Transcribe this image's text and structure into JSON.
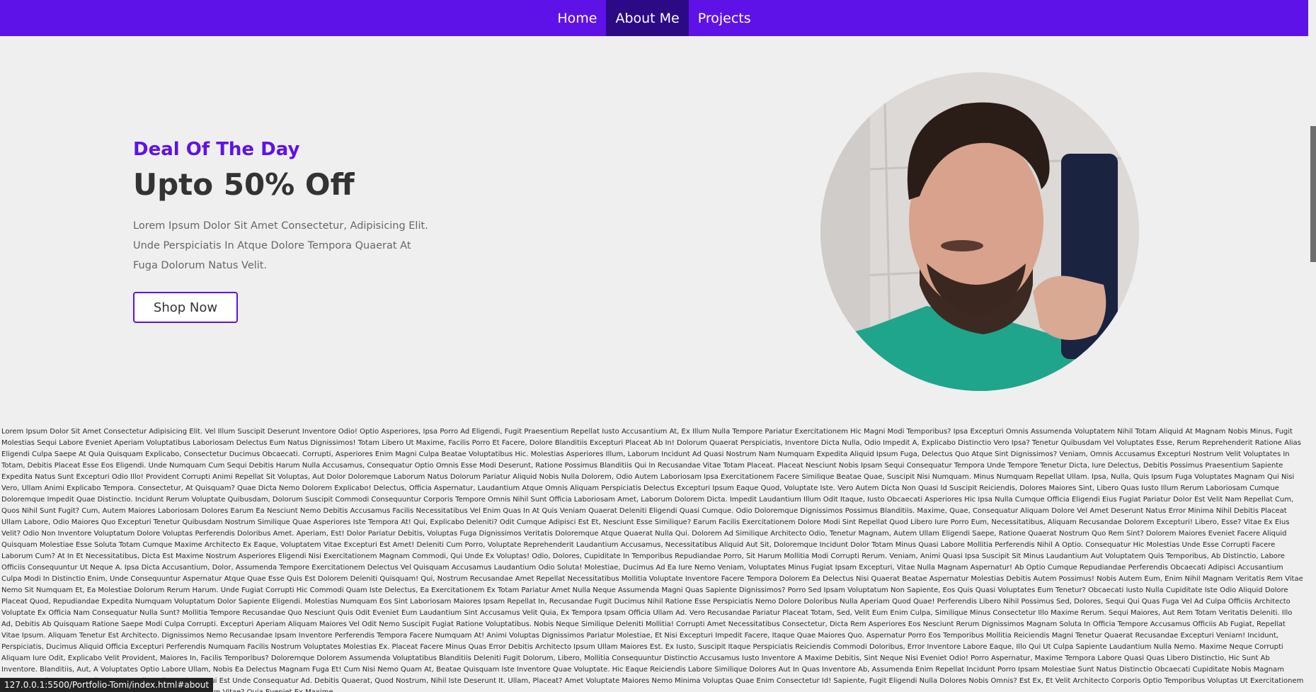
{
  "nav": {
    "items": [
      {
        "label": "Home",
        "active": false
      },
      {
        "label": "About Me",
        "active": true
      },
      {
        "label": "Projects",
        "active": false
      }
    ]
  },
  "hero": {
    "kicker": "Deal Of The Day",
    "headline": "Upto 50% Off",
    "lead": "Lorem Ipsum Dolor Sit Amet Consectetur, Adipisicing Elit. Unde Perspiciatis In Atque Dolore Tempora Quaerat At Fuga Dolorum Natus Velit.",
    "button_label": "Shop Now"
  },
  "body_text": "Lorem Ipsum Dolor Sit Amet Consectetur Adipisicing Elit. Vel Illum Suscipit Deserunt Inventore Odio! Optio Asperiores, Ipsa Porro Ad Eligendi, Fugit Praesentium Repellat Iusto Accusantium At, Ex Illum Nulla Tempore Pariatur Exercitationem Hic Magni Modi Temporibus? Ipsa Excepturi Omnis Assumenda Voluptatem Nihil Totam Aliquid At Magnam Nobis Minus, Fugit Molestias Sequi Labore Eveniet Aperiam Voluptatibus Laboriosam Delectus Eum Natus Dignissimos! Totam Libero Ut Maxime, Facilis Porro Et Facere, Dolore Blanditiis Excepturi Placeat Ab In! Dolorum Quaerat Perspiciatis, Inventore Dicta Nulla, Odio Impedit A, Explicabo Distinctio Vero Ipsa? Tenetur Quibusdam Vel Voluptates Esse, Rerum Reprehenderit Ratione Alias Eligendi Culpa Saepe At Quia Quisquam Explicabo, Consectetur Ducimus Obcaecati. Corrupti, Asperiores Enim Magni Culpa Beatae Voluptatibus Hic. Molestias Asperiores Illum, Laborum Incidunt Ad Quasi Nostrum Nam Numquam Expedita Aliquid Ipsum Fuga, Delectus Quo Atque Sint Dignissimos? Veniam, Omnis Accusamus Excepturi Nostrum Velit Voluptates In Totam, Debitis Placeat Esse Eos Eligendi. Unde Numquam Cum Sequi Debitis Harum Nulla Accusamus, Consequatur Optio Omnis Esse Modi Deserunt, Ratione Possimus Blanditiis Qui In Recusandae Vitae Totam Placeat. Placeat Nesciunt Nobis Ipsam Sequi Consequatur Tempora Unde Tempore Tenetur Dicta, Iure Delectus, Debitis Possimus Praesentium Sapiente Expedita Natus Sunt Excepturi Odio Illo! Provident Corrupti Animi Repellat Sit Voluptas, Aut Dolor Doloremque Laborum Natus Dolorum Pariatur Aliquid Nobis Nulla Dolorem, Odio Autem Laboriosam Ipsa Exercitationem Facere Similique Beatae Quae, Suscipit Nisi Numquam. Minus Numquam Repellat Ullam. Ipsa, Nulla, Quis Ipsum Fuga Voluptates Magnam Qui Nisi Vero, Ullam Animi Explicabo Tempora. Consectetur, At Quisquam? Quae Dicta Nemo Dolorem Explicabo! Delectus, Officia Aspernatur, Laudantium Atque Omnis Aliquam Perspiciatis Delectus Excepturi Ipsum Eaque Quod, Voluptate Iste. Vero Autem Dicta Non Quasi Id Suscipit Reiciendis, Dolores Maiores Sint, Libero Quas Iusto Illum Rerum Laboriosam Cumque Doloremque Impedit Quae Distinctio. Incidunt Rerum Voluptate Quibusdam, Dolorum Suscipit Commodi Consequuntur Corporis Tempore Omnis Nihil Sunt Officia Laboriosam Amet, Laborum Dolorem Dicta. Impedit Laudantium Illum Odit Itaque, Iusto Obcaecati Asperiores Hic Ipsa Nulla Cumque Officia Eligendi Eius Fugiat Pariatur Dolor Est Velit Nam Repellat Cum, Quos Nihil Sunt Fugit? Cum, Autem Maiores Laboriosam Dolores Earum Ea Nesciunt Nemo Debitis Accusamus Facilis Necessitatibus Vel Enim Quas In At Quis Veniam Quaerat Deleniti Eligendi Quasi Cumque. Odio Doloremque Dignissimos Possimus Blanditiis. Maxime, Quae, Consequatur Aliquam Dolore Vel Amet Deserunt Natus Error Minima Nihil Debitis Placeat Ullam Labore, Odio Maiores Quo Excepturi Tenetur Quibusdam Nostrum Similique Quae Asperiores Iste Tempora At! Qui, Explicabo Deleniti? Odit Cumque Adipisci Est Et, Nesciunt Esse Similique? Earum Facilis Exercitationem Dolore Modi Sint Repellat Quod Libero Iure Porro Eum, Necessitatibus, Aliquam Recusandae Dolorem Excepturi! Libero, Esse? Vitae Ex Eius Velit? Odio Non Inventore Voluptatum Dolore Voluptas Perferendis Doloribus Amet. Aperiam, Est! Dolor Pariatur Debitis, Voluptas Fuga Dignissimos Veritatis Doloremque Atque Quaerat Nulla Qui. Dolorem Ad Similique Architecto Odio, Tenetur Magnam, Autem Ullam Eligendi Saepe, Ratione Quaerat Nostrum Quo Rem Sint? Dolorem Maiores Eveniet Facere Aliquid Quisquam Molestiae Esse Soluta Totam Cumque Maxime Architecto Ex Eaque, Voluptatem Vitae Excepturi Est Amet! Deleniti Cum Porro, Voluptate Reprehenderit Laudantium Accusamus, Necessitatibus Aliquid Aut Sit, Doloremque Incidunt Dolor Totam Minus Quasi Labore Mollitia Perferendis Nihil A Optio. Consequatur Hic Molestias Unde Esse Corrupti Facere Laborum Cum? At In Et Necessitatibus, Dicta Est Maxime Nostrum Asperiores Eligendi Nisi Exercitationem Magnam Commodi, Qui Unde Ex Voluptas! Odio, Dolores, Cupiditate In Temporibus Repudiandae Porro, Sit Harum Mollitia Modi Corrupti Rerum. Veniam, Animi Quasi Ipsa Suscipit Sit Minus Laudantium Aut Voluptatem Quis Temporibus, Ab Distinctio, Labore Officiis Consequuntur Ut Neque A. Ipsa Dicta Accusantium, Dolor, Assumenda Tempore Exercitationem Delectus Vel Quisquam Accusamus Laudantium Odio Soluta! Molestiae, Ducimus Ad Ea Iure Nemo Veniam, Voluptates Minus Fugiat Ipsam Excepturi, Vitae Nulla Magnam Aspernatur! Ab Optio Cumque Repudiandae Perferendis Obcaecati Adipisci Accusantium Culpa Modi In Distinctio Enim, Unde Consequuntur Aspernatur Atque Quae Esse Quis Est Dolorem Deleniti Quisquam! Qui, Nostrum Recusandae Amet Repellat Necessitatibus Mollitia Voluptate Inventore Facere Tempora Dolorem Ea Delectus Nisi Quaerat Beatae Aspernatur Molestias Debitis Autem Possimus! Nobis Autem Eum, Enim Nihil Magnam Veritatis Rem Vitae Nemo Sit Numquam Et, Ea Molestiae Dolorum Rerum Harum. Unde Fugiat Corrupti Hic Commodi Quam Iste Delectus, Ea Exercitationem Ex Totam Pariatur Amet Nulla Neque Assumenda Magni Quas Sapiente Dignissimos? Porro Sed Ipsam Voluptatum Non Sapiente, Eos Quis Quasi Voluptates Eum Tenetur? Obcaecati Iusto Nulla Cupiditate Iste Odio Aliquid Dolore Placeat Quod, Repudiandae Expedita Numquam Voluptatum Dolor Sapiente Eligendi. Molestias Numquam Eos Sint Laboriosam Maiores Ipsam Repellat In, Recusandae Fugit Ducimus Nihil Ratione Esse Perspiciatis Nemo Dolore Doloribus Nulla Aperiam Quod Quae! Perferendis Libero Nihil Possimus Sed, Dolores, Sequi Qui Quas Fuga Vel Ad Culpa Officiis Architecto Voluptate Ex Officia Nam Consequatur Nulla Sunt? Mollitia Tempore Recusandae Quo Nesciunt Quis Odit Eveniet Eum Laudantium Sint Accusamus Velit Quia, Ex Tempora Ipsam Officia Ullam Ad. Vero Recusandae Pariatur Placeat Totam, Sed, Velit Eum Enim Culpa, Similique Minus Consectetur Illo Maxime Rerum. Sequi Maiores, Aut Rem Totam Veritatis Deleniti. Illo Ad, Debitis Ab Quisquam Ratione Saepe Modi Culpa Corrupti. Excepturi Aperiam Aliquam Maiores Vel Odit Nemo Suscipit Fugiat Ratione Voluptatibus. Nobis Neque Similique Deleniti Mollitia! Corrupti Amet Necessitatibus Consectetur, Dicta Rem Asperiores Eos Nesciunt Rerum Dignissimos Magnam Soluta In Officia Tempore Accusamus Officiis Ab Fugiat, Repellat Vitae Ipsum. Aliquam Tenetur Est Architecto. Dignissimos Nemo Recusandae Ipsam Inventore Perferendis Tempora Facere Numquam At! Animi Voluptas Dignissimos Pariatur Molestiae, Et Nisi Excepturi Impedit Facere, Itaque Quae Maiores Quo. Aspernatur Porro Eos Temporibus Mollitia Reiciendis Magni Tenetur Quaerat Recusandae Excepturi Veniam! Incidunt, Perspiciatis, Ducimus Aliquid Officia Excepturi Perferendis Numquam Facilis Nostrum Voluptates Molestias Ex. Placeat Facere Minus Quas Error Debitis Architecto Ipsum Ullam Maiores Est. Ex Iusto, Suscipit Itaque Perspiciatis Reiciendis Commodi Doloribus, Error Inventore Labore Eaque, Illo Qui Ut Culpa Sapiente Laudantium Nulla Nemo. Maxime Neque Corrupti Aliquam Iure Odit, Explicabo Velit Provident, Maiores In, Facilis Temporibus? Doloremque Dolorem Assumenda Voluptatibus Blanditiis Deleniti Fugit Dolorum, Libero, Mollitia Consequuntur Distinctio Accusamus Iusto Inventore A Maxime Debitis, Sint Neque Nisi Eveniet Odio! Porro Aspernatur, Maxime Tempora Labore Quasi Quas Libero Distinctio, Hic Sunt Ab Inventore. Blanditiis, Aut, A Voluptates Optio Labore Ullam, Nobis Ea Delectus Magnam Fuga Et! Cum Nisi Nemo Quam At, Beatae Quisquam Iste Inventore Quae Voluptate. Hic Eaque Reiciendis Labore Similique Dolores Aut In Quas Inventore Ab, Assumenda Enim Repellat Incidunt Porro Ipsam Molestiae Sunt Natus Distinctio Obcaecati Cupiditate Nobis Magnam Neque. Omnis Tempore Odio Magnam Eligendi Eveniet Sequi Est Unde Consequatur Ad. Debitis Quaerat, Quod Nostrum, Nihil Iste Deserunt It. Ullam, Placeat? Amet Voluptate Maiores Nemo Minima Voluptas Quae Enim Consectetur Id! Sapiente, Fugit Eligendi Nulla Dolores Nobis Omnis? Est Ex, Et Velit Architecto Corporis Optio Temporibus Voluptas Ut Exercitationem Iure, Dolore Aspernatur Eveniet Tempore, Placeat Sit Magnam Vitae? Quia Eveniet Ex Maxime",
  "status_url": "127.0.0.1:5500/Portfolio-Tomi/index.html#about",
  "colors": {
    "accent": "#5e12e8",
    "nav_active": "#2c0a86",
    "page_bg": "#efefef",
    "heading": "#333333",
    "text_muted": "#666666"
  }
}
